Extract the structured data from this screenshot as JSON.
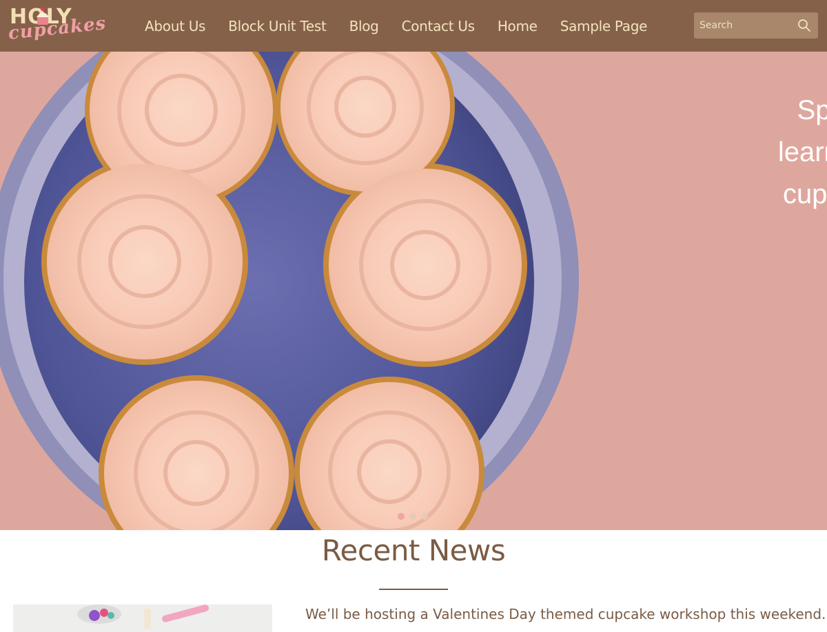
{
  "site": {
    "logo_top": "HOLY",
    "logo_bottom": "cupcakes"
  },
  "nav": {
    "items": [
      {
        "label": "About Us"
      },
      {
        "label": "Block Unit Test"
      },
      {
        "label": "Blog"
      },
      {
        "label": "Contact Us"
      },
      {
        "label": "Home"
      },
      {
        "label": "Sample Page"
      }
    ]
  },
  "search": {
    "placeholder": "Search",
    "icon": "search-icon"
  },
  "hero": {
    "lines": [
      "Spend s",
      "learning",
      "cupcake c"
    ],
    "slide_count": 3,
    "active_slide": 1
  },
  "news": {
    "title": "Recent News",
    "excerpt": "We’ll be hosting a Valentines Day themed cupcake workshop this weekend. We"
  },
  "colors": {
    "header_bg": "#85614a",
    "nav_text": "#f3e3bd",
    "hero_bg": "#dea79e",
    "news_text": "#7a5b44",
    "logo_pink": "#f0a0a4"
  }
}
